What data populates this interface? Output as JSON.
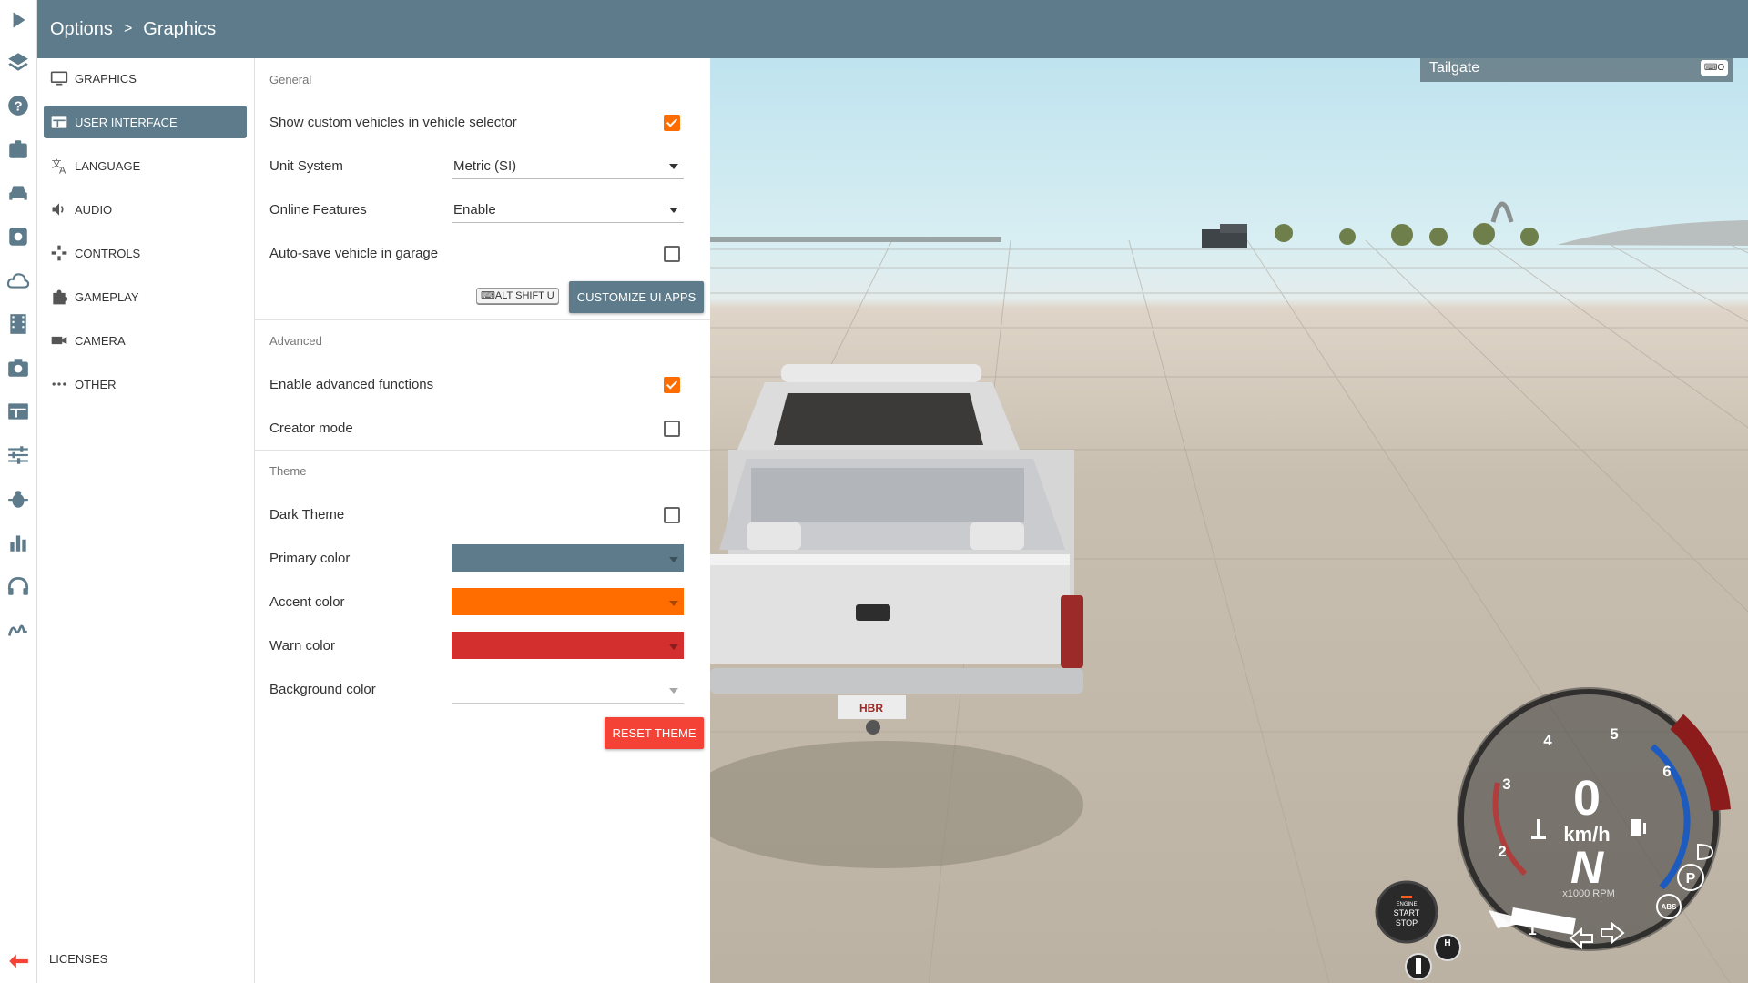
{
  "header": {
    "crumb_root": "Options",
    "separator": ">",
    "crumb_current": "Graphics"
  },
  "rail": {
    "icons": [
      "play-icon",
      "layers-icon",
      "help-icon",
      "mission-icon",
      "car-icon",
      "settings-icon",
      "cloud-icon",
      "film-icon",
      "camera-icon",
      "layout-icon",
      "sliders-icon",
      "bug-icon",
      "chart-icon",
      "headphones-icon",
      "signature-icon",
      "back-arrow-icon"
    ]
  },
  "menu": {
    "items": [
      {
        "label": "GRAPHICS",
        "icon": "monitor-icon"
      },
      {
        "label": "USER INTERFACE",
        "icon": "ui-panel-icon",
        "active": true
      },
      {
        "label": "LANGUAGE",
        "icon": "translate-icon"
      },
      {
        "label": "AUDIO",
        "icon": "speaker-icon"
      },
      {
        "label": "CONTROLS",
        "icon": "gamepad-icon"
      },
      {
        "label": "GAMEPLAY",
        "icon": "puzzle-icon"
      },
      {
        "label": "CAMERA",
        "icon": "videocam-icon"
      },
      {
        "label": "OTHER",
        "icon": "more-icon"
      }
    ],
    "licenses": "LICENSES"
  },
  "panel": {
    "general_title": "General",
    "show_custom_vehicles": {
      "label": "Show custom vehicles in vehicle selector",
      "checked": true
    },
    "unit_system": {
      "label": "Unit System",
      "value": "Metric (SI)"
    },
    "online_features": {
      "label": "Online Features",
      "value": "Enable"
    },
    "autosave_garage": {
      "label": "Auto-save vehicle in garage",
      "checked": false
    },
    "shortcut_key": "ALT SHIFT U",
    "customize_button": "CUSTOMIZE UI APPS",
    "advanced_title": "Advanced",
    "enable_advanced": {
      "label": "Enable advanced functions",
      "checked": true
    },
    "creator_mode": {
      "label": "Creator mode",
      "checked": false
    },
    "theme_title": "Theme",
    "dark_theme": {
      "label": "Dark Theme",
      "checked": false
    },
    "primary_color": {
      "label": "Primary color",
      "value": "#5d7b8a"
    },
    "accent_color": {
      "label": "Accent color",
      "value": "#ff6d00"
    },
    "warn_color": {
      "label": "Warn color",
      "value": "#d32f2f"
    },
    "background_color": {
      "label": "Background color",
      "value": ""
    },
    "reset_button": "RESET THEME"
  },
  "hud": {
    "tailgate_label": "Tailgate",
    "speed": "0",
    "speed_unit": "km/h",
    "gear": "N",
    "rpm_unit": "x1000 RPM",
    "rpm_ticks": [
      "1",
      "2",
      "3",
      "4",
      "5",
      "6"
    ],
    "engine_button": {
      "line1": "ENGINE",
      "line2": "START",
      "line3": "STOP"
    },
    "parking_label": "P",
    "abs_label": "ABS",
    "handbrake_label": "H",
    "license_plate": "HBR"
  }
}
